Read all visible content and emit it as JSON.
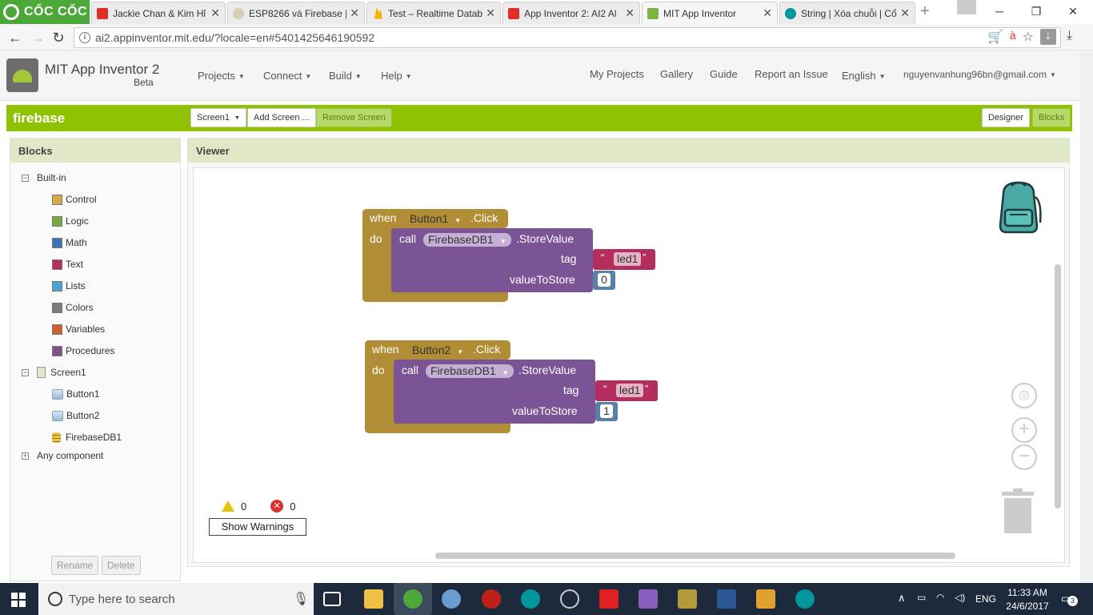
{
  "browser": {
    "brand": "CỐC CỐC",
    "tabs": [
      {
        "title": "Jackie Chan & Kim Hỉ",
        "favicon_color": "#e52d27"
      },
      {
        "title": "ESP8266 và Firebase |",
        "favicon_color": "#c8b89a"
      },
      {
        "title": "Test – Realtime Datab",
        "favicon_color": "#f5b400"
      },
      {
        "title": "App Inventor 2: AI2 Al",
        "favicon_color": "#e52d27"
      },
      {
        "title": "MIT App Inventor",
        "favicon_color": "#7cb342"
      },
      {
        "title": "String | Xóa chuỗi | Cổ",
        "favicon_color": "#00979c"
      }
    ],
    "url": "ai2.appinventor.mit.edu/?locale=en#5401425646190592"
  },
  "app": {
    "title": "MIT App Inventor 2",
    "beta": "Beta",
    "menus": [
      "Projects",
      "Connect",
      "Build",
      "Help"
    ],
    "links": [
      "My Projects",
      "Gallery",
      "Guide",
      "Report an Issue",
      "English",
      "nguyenvanhung96bn@gmail.com"
    ]
  },
  "project": {
    "name": "firebase",
    "screen_select": "Screen1",
    "add_screen": "Add Screen ...",
    "remove_screen": "Remove Screen",
    "designer": "Designer",
    "blocks": "Blocks"
  },
  "blocks_panel": {
    "title": "Blocks",
    "builtin_label": "Built-in",
    "builtin": [
      {
        "label": "Control",
        "color": "#d8a94a"
      },
      {
        "label": "Logic",
        "color": "#77ab41"
      },
      {
        "label": "Math",
        "color": "#3f71b5"
      },
      {
        "label": "Text",
        "color": "#b32d5e"
      },
      {
        "label": "Lists",
        "color": "#49a6d4"
      },
      {
        "label": "Colors",
        "color": "#7d7d7d"
      },
      {
        "label": "Variables",
        "color": "#d05f2d"
      },
      {
        "label": "Procedures",
        "color": "#7c5385"
      }
    ],
    "screen": "Screen1",
    "components": [
      "Button1",
      "Button2",
      "FirebaseDB1"
    ],
    "any_component": "Any component",
    "rename": "Rename",
    "delete": "Delete"
  },
  "viewer": {
    "title": "Viewer",
    "blocks": [
      {
        "when": "when",
        "component": "Button1",
        "event": ".Click",
        "do": "do",
        "call": "call",
        "db": "FirebaseDB1",
        "method": ".StoreValue",
        "tag_label": "tag",
        "tag_value": "led1",
        "vts_label": "valueToStore",
        "vts_value": "0"
      },
      {
        "when": "when",
        "component": "Button2",
        "event": ".Click",
        "do": "do",
        "call": "call",
        "db": "FirebaseDB1",
        "method": ".StoreValue",
        "tag_label": "tag",
        "tag_value": "led1",
        "vts_label": "valueToStore",
        "vts_value": "1"
      }
    ],
    "warnings_count": "0",
    "errors_count": "0",
    "show_warnings": "Show Warnings"
  },
  "taskbar": {
    "search_placeholder": "Type here to search",
    "lang": "ENG",
    "time": "11:33 AM",
    "date": "24/6/2017",
    "notifications": "3"
  }
}
